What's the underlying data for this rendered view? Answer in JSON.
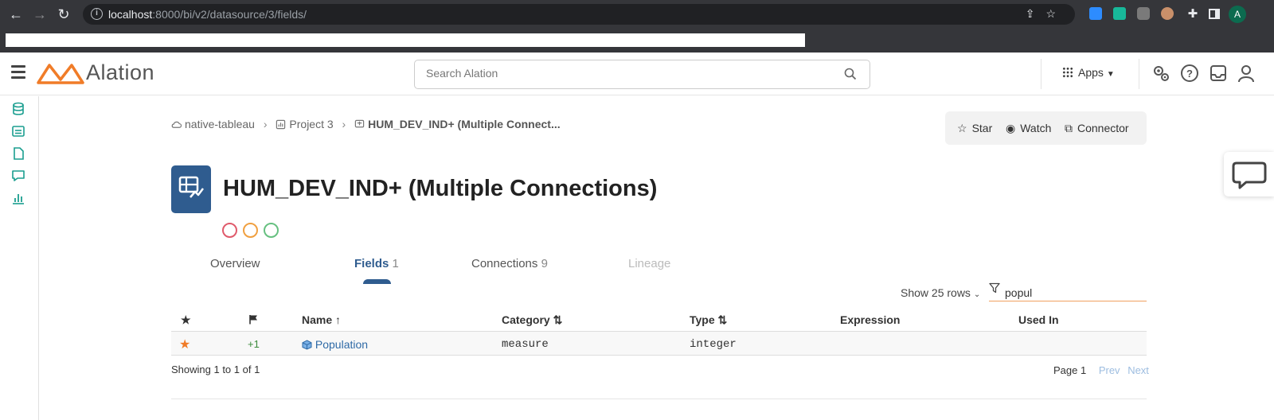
{
  "browser": {
    "url_host": "localhost",
    "url_path": ":8000/bi/v2/datasource/3/fields/",
    "profile_initial": "A"
  },
  "header": {
    "logo_text": "Alation",
    "search_placeholder": "Search Alation",
    "apps_label": "Apps"
  },
  "breadcrumb": {
    "items": [
      "native-tableau",
      "Project 3",
      "HUM_DEV_IND+ (Multiple Connect..."
    ]
  },
  "actions": {
    "star": "Star",
    "watch": "Watch",
    "connector": "Connector"
  },
  "page": {
    "title": "HUM_DEV_IND+ (Multiple Connections)",
    "status_dot_colors": [
      "#e05a6b",
      "#f0a040",
      "#66c080"
    ]
  },
  "tabs": [
    {
      "label": "Overview",
      "count": ""
    },
    {
      "label": "Fields",
      "count": "1"
    },
    {
      "label": "Connections",
      "count": "9"
    },
    {
      "label": "Lineage",
      "count": ""
    }
  ],
  "table": {
    "show_rows": "Show 25 rows",
    "filter_value": "popul",
    "columns": {
      "name": "Name",
      "category": "Category",
      "type": "Type",
      "expression": "Expression",
      "used_in": "Used In"
    },
    "rows": [
      {
        "flag": "+1",
        "name": "Population",
        "category": "measure",
        "type": "integer",
        "expression": "",
        "used_in": ""
      }
    ],
    "showing": "Showing 1 to 1 of 1",
    "page": "Page 1",
    "prev": "Prev",
    "next": "Next"
  },
  "colors": {
    "brand_orange": "#f07c28",
    "primary_blue": "#2f5c8f",
    "rail_green": "#1a9e8f"
  }
}
